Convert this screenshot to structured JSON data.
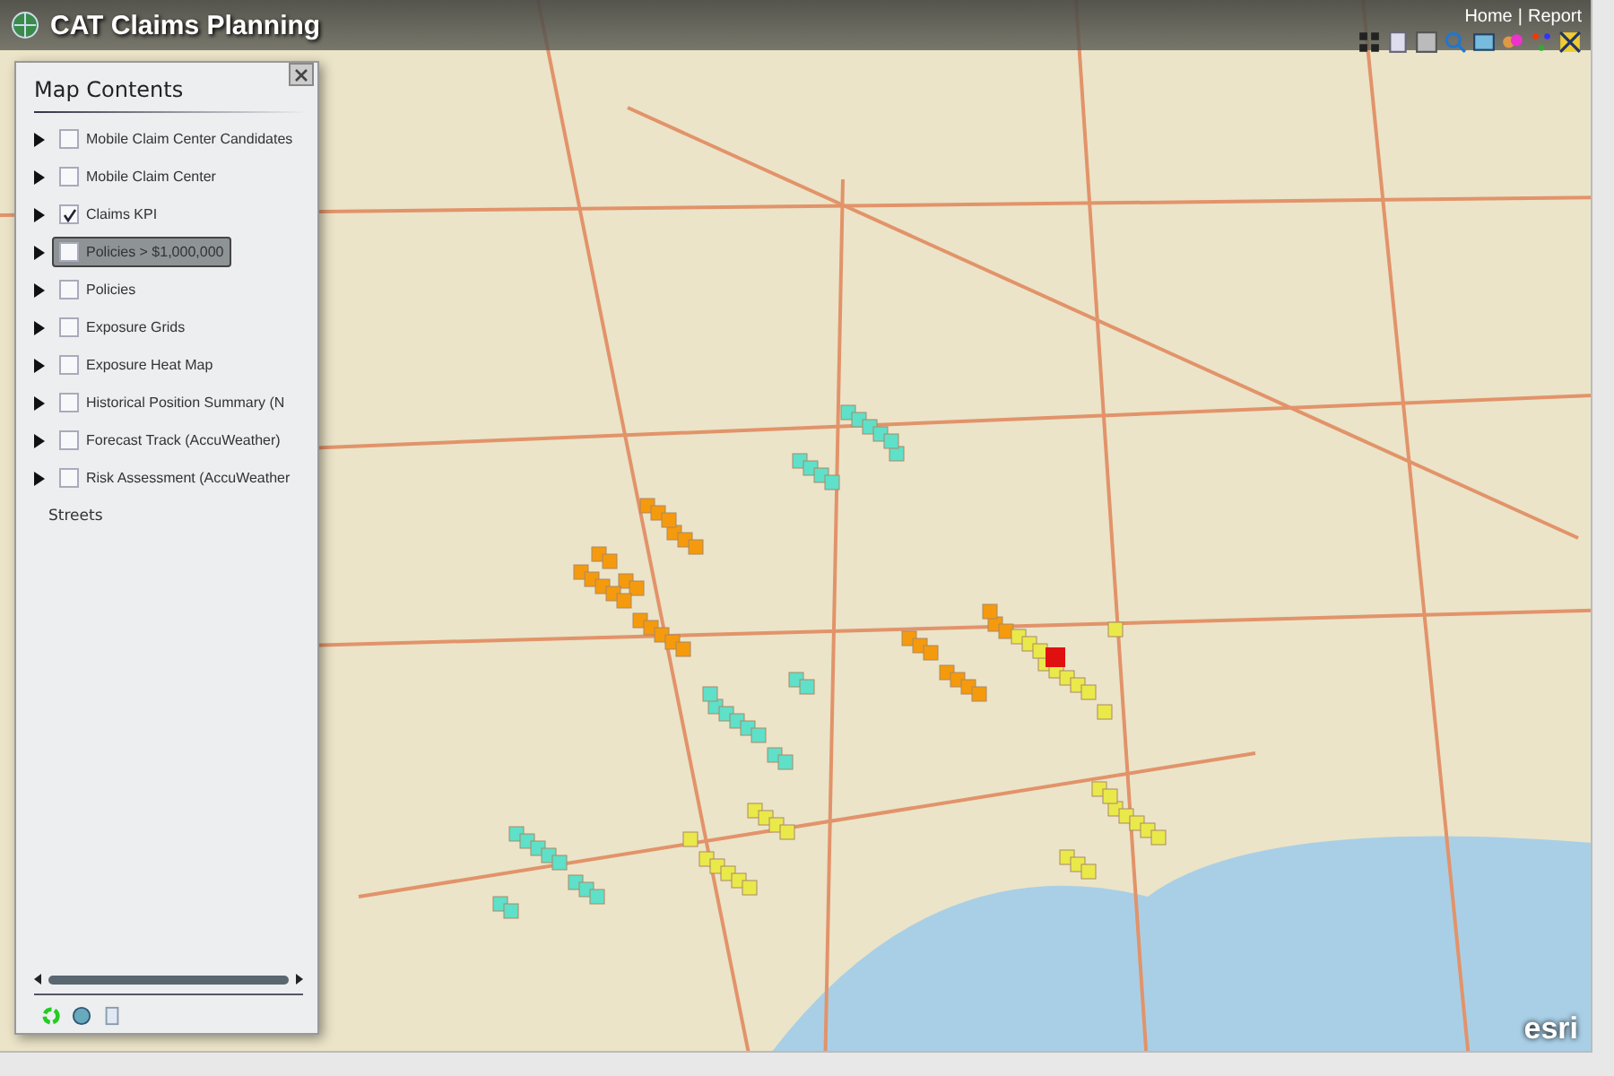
{
  "window": {
    "title": "CAT Claims Planning"
  },
  "header_links": [
    {
      "label": "Home"
    },
    {
      "label": "Report"
    }
  ],
  "link_separator": "|",
  "panel": {
    "title": "Map Contents",
    "layers": [
      {
        "label": "Mobile Claim Center Candidates",
        "checked": false,
        "selected": false
      },
      {
        "label": "Mobile Claim Center",
        "checked": false,
        "selected": false
      },
      {
        "label": "Claims KPI",
        "checked": true,
        "selected": false
      },
      {
        "label": "Policies > $1,000,000",
        "checked": false,
        "selected": true
      },
      {
        "label": "Policies",
        "checked": false,
        "selected": false
      },
      {
        "label": "Exposure Grids",
        "checked": false,
        "selected": false
      },
      {
        "label": "Exposure Heat Map",
        "checked": false,
        "selected": false
      },
      {
        "label": "Historical Position Summary (N",
        "checked": false,
        "selected": false
      },
      {
        "label": "Forecast Track (AccuWeather)",
        "checked": false,
        "selected": false
      },
      {
        "label": "Risk Assessment (AccuWeather",
        "checked": false,
        "selected": false
      }
    ],
    "basemap": "Streets"
  },
  "map_credit": "esri"
}
